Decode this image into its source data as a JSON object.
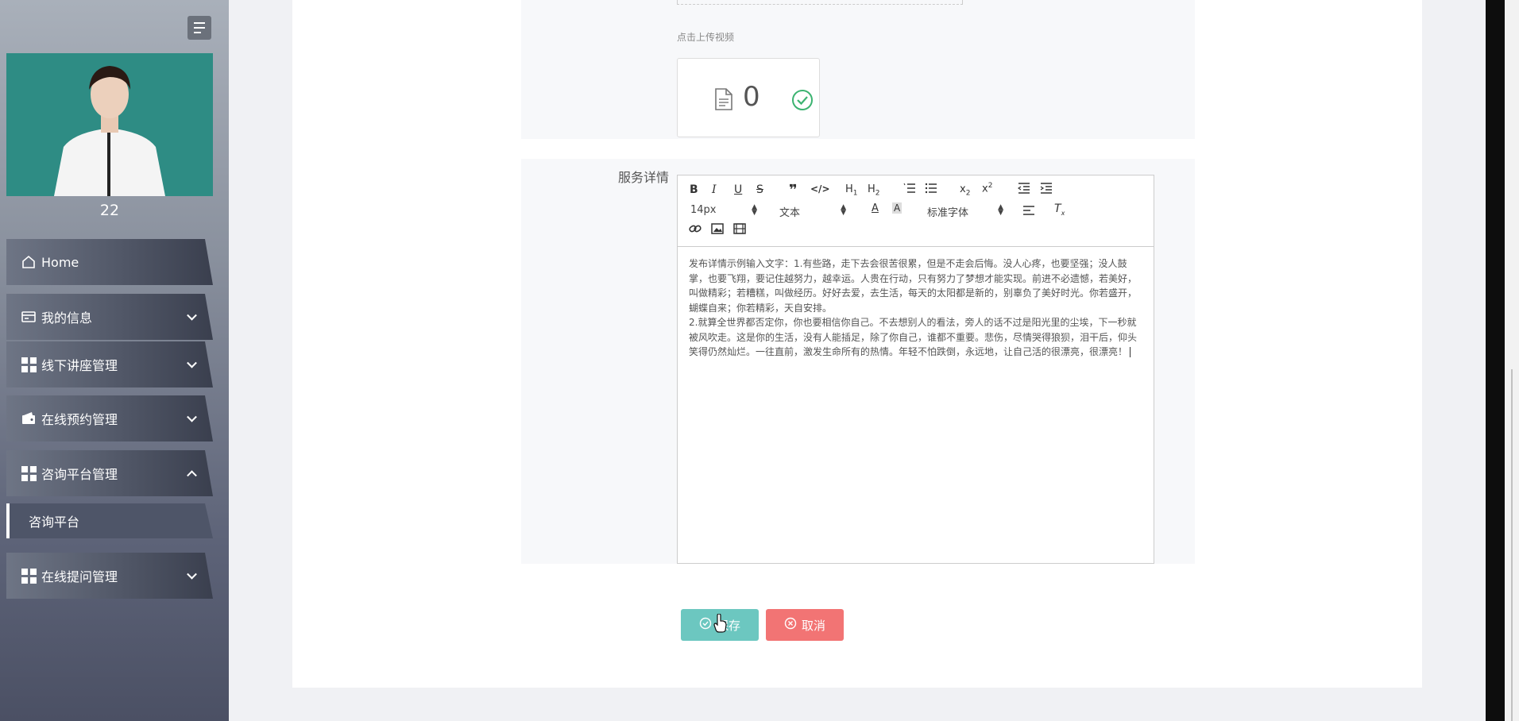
{
  "user": {
    "name": "22"
  },
  "sidebar": {
    "items": [
      {
        "label": "Home"
      },
      {
        "label": "我的信息"
      },
      {
        "label": "线下讲座管理"
      },
      {
        "label": "在线预约管理"
      },
      {
        "label": "咨询平台管理"
      },
      {
        "label": "在线提问管理"
      }
    ],
    "subitems": [
      {
        "label": "咨询平台"
      }
    ]
  },
  "upload": {
    "hint": "点击上传视频",
    "file_count": "0"
  },
  "form": {
    "details_label": "服务详情"
  },
  "editor": {
    "font_size": "14px",
    "paragraph": "文本",
    "font_family": "标准字体",
    "text_p1": "发布详情示例输入文字：1.有些路，走下去会很苦很累，但是不走会后悔。没人心疼，也要坚强；没人鼓掌，也要飞翔，要记住越努力，越幸运。人贵在行动，只有努力了梦想才能实现。前进不必遗憾，若美好，叫做精彩；若糟糕，叫做经历。好好去爱，去生活，每天的太阳都是新的，别辜负了美好时光。你若盛开，蝴蝶自来；你若精彩，天自安排。",
    "text_p2": "2.就算全世界都否定你，你也要相信你自己。不去想别人的看法，旁人的话不过是阳光里的尘埃，下一秒就被风吹走。这是你的生活，没有人能插足，除了你自己，谁都不重要。悲伤，尽情哭得狼狈，泪干后，仰头笑得仍然灿烂。一往直前，激发生命所有的热情。年轻不怕跌倒，永远地，让自己活的很漂亮，很漂亮！"
  },
  "buttons": {
    "save": "保存",
    "cancel": "取消"
  },
  "colors": {
    "accent": "#6cc7c0",
    "danger": "#f27474",
    "avatar_bg": "#2e8c84"
  }
}
